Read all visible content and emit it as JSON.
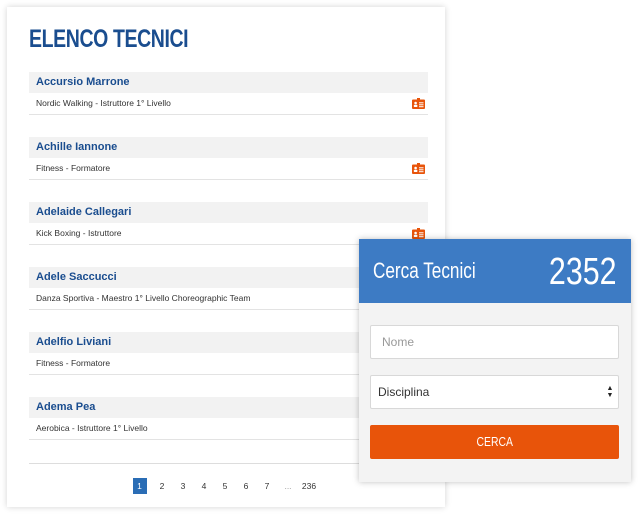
{
  "list": {
    "title": "ELENCO TECNICI",
    "items": [
      {
        "name": "Accursio Marrone",
        "discipline": "Nordic Walking - Istruttore 1° Livello",
        "badge": true
      },
      {
        "name": "Achille Iannone",
        "discipline": "Fitness - Formatore",
        "badge": true
      },
      {
        "name": "Adelaide Callegari",
        "discipline": "Kick Boxing - Istruttore",
        "badge": true
      },
      {
        "name": "Adele Saccucci",
        "discipline": "Danza Sportiva - Maestro 1° Livello Choreographic Team",
        "badge": false
      },
      {
        "name": "Adelfio Liviani",
        "discipline": "Fitness - Formatore",
        "badge": false
      },
      {
        "name": "Adema Pea",
        "discipline": "Aerobica - Istruttore 1° Livello",
        "badge": false
      }
    ]
  },
  "pagination": {
    "pages": [
      "1",
      "2",
      "3",
      "4",
      "5",
      "6",
      "7",
      "...",
      "236"
    ],
    "active": "1"
  },
  "search": {
    "title": "Cerca Tecnici",
    "count": "2352",
    "name_placeholder": "Nome",
    "discipline_label": "Disciplina",
    "button_label": "CERCA"
  },
  "colors": {
    "brand_blue": "#1a4d8f",
    "header_blue": "#3d7bc4",
    "accent_orange": "#e8540a"
  },
  "icons": {
    "badge": "id-card-icon"
  }
}
